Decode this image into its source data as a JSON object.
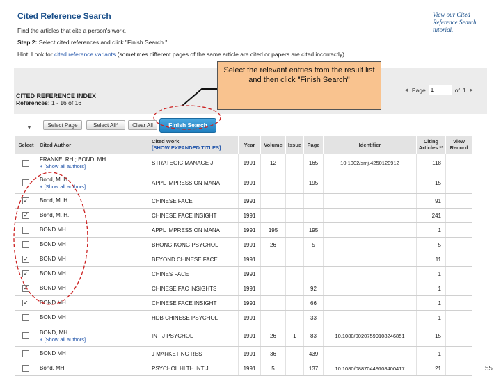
{
  "header": {
    "title": "Cited Reference Search",
    "subtitle": "Find the articles that cite a person's work.",
    "step2_label": "Step 2:",
    "step2_text": "Select cited references and click \"Finish Search.\"",
    "hint_label": "Hint: Look for",
    "hint_link": "cited reference variants",
    "hint_text": "(sometimes different pages of the same article are cited or papers are cited incorrectly)",
    "tutorial_link": "View our Cited Reference Search tutorial."
  },
  "index": {
    "title": "CITED REFERENCE INDEX",
    "references_label": "References:",
    "references_range": "1 - 16 of 16"
  },
  "pager": {
    "prev_arrow": "◄",
    "page_label": "Page",
    "page_value": "1",
    "of_label": "of",
    "total_pages": "1",
    "next_arrow": "►"
  },
  "toolbar": {
    "sort_arrow": "▼",
    "select_page": "Select Page",
    "select_all": "Select All*",
    "clear_all": "Clear All",
    "finish_search": "Finish Search"
  },
  "columns": {
    "select": "Select",
    "cited_author": "Cited Author",
    "cited_work": "Cited Work",
    "show_expanded": "[SHOW EXPANDED TITLES]",
    "year": "Year",
    "volume": "Volume",
    "issue": "Issue",
    "page": "Page",
    "identifier": "Identifier",
    "citing_articles": "Citing Articles **",
    "view_record": "View Record"
  },
  "rows": [
    {
      "checked": "",
      "author": "FRANKE, RH ; BOND, MH",
      "show_all": "+ [Show all authors]",
      "work": "STRATEGIC MANAGE J",
      "year": "1991",
      "volume": "12",
      "issue": "",
      "page": "165",
      "identifier": "10.1002/smj.4250120912",
      "citing": "118"
    },
    {
      "checked": "",
      "author": "Bond, M. H.",
      "show_all": "+ [Show all authors]",
      "work": "APPL IMPRESSION MANA",
      "year": "1991",
      "volume": "",
      "issue": "",
      "page": "195",
      "identifier": "",
      "citing": "15"
    },
    {
      "checked": "✓",
      "author": "Bond, M. H.",
      "show_all": "",
      "work": "CHINESE FACE",
      "year": "1991",
      "volume": "",
      "issue": "",
      "page": "",
      "identifier": "",
      "citing": "91"
    },
    {
      "checked": "✓",
      "author": "Bond, M. H.",
      "show_all": "",
      "work": "CHINESE FACE INSIGHT",
      "year": "1991",
      "volume": "",
      "issue": "",
      "page": "",
      "identifier": "",
      "citing": "241"
    },
    {
      "checked": "",
      "author": "BOND MH",
      "show_all": "",
      "work": "APPL IMPRESSION MANA",
      "year": "1991",
      "volume": "195",
      "issue": "",
      "page": "195",
      "identifier": "",
      "citing": "1"
    },
    {
      "checked": "",
      "author": "BOND MH",
      "show_all": "",
      "work": "BHONG KONG PSYCHOL",
      "year": "1991",
      "volume": "26",
      "issue": "",
      "page": "5",
      "identifier": "",
      "citing": "5"
    },
    {
      "checked": "✓",
      "author": "BOND MH",
      "show_all": "",
      "work": "BEYOND CHINESE FACE",
      "year": "1991",
      "volume": "",
      "issue": "",
      "page": "",
      "identifier": "",
      "citing": "11"
    },
    {
      "checked": "✓",
      "author": "BOND MH",
      "show_all": "",
      "work": "CHINES FACE",
      "year": "1991",
      "volume": "",
      "issue": "",
      "page": "",
      "identifier": "",
      "citing": "1"
    },
    {
      "checked": "✓",
      "author": "BOND MH",
      "show_all": "",
      "work": "CHINESE FAC INSIGHTS",
      "year": "1991",
      "volume": "",
      "issue": "",
      "page": "92",
      "identifier": "",
      "citing": "1"
    },
    {
      "checked": "✓",
      "author": "BOND MH",
      "show_all": "",
      "work": "CHINESE FACE INSIGHT",
      "year": "1991",
      "volume": "",
      "issue": "",
      "page": "66",
      "identifier": "",
      "citing": "1"
    },
    {
      "checked": "",
      "author": "BOND MH",
      "show_all": "",
      "work": "HDB CHINESE PSYCHOL",
      "year": "1991",
      "volume": "",
      "issue": "",
      "page": "33",
      "identifier": "",
      "citing": "1"
    },
    {
      "checked": "",
      "author": "BOND, MH",
      "show_all": "+ [Show all authors]",
      "work": "INT J PSYCHOL",
      "year": "1991",
      "volume": "26",
      "issue": "1",
      "page": "83",
      "identifier": "10.1080/00207599108246851",
      "citing": "15"
    },
    {
      "checked": "",
      "author": "BOND MH",
      "show_all": "",
      "work": "J MARKETING RES",
      "year": "1991",
      "volume": "36",
      "issue": "",
      "page": "439",
      "identifier": "",
      "citing": "1"
    },
    {
      "checked": "",
      "author": "Bond, MH",
      "show_all": "",
      "work": "PSYCHOL HLTH INT J",
      "year": "1991",
      "volume": "5",
      "issue": "",
      "page": "137",
      "identifier": "10.1080/08870449108400417",
      "citing": "21"
    }
  ],
  "callout": {
    "text": "Select the relevant entries from the result list and then click \"Finish Search\""
  },
  "slide_number": "55",
  "colors": {
    "title_blue": "#1a4f8a",
    "finish_button": "#1f7fc0",
    "callout_fill": "#f9c38f",
    "annotation_red": "#cc2222"
  }
}
